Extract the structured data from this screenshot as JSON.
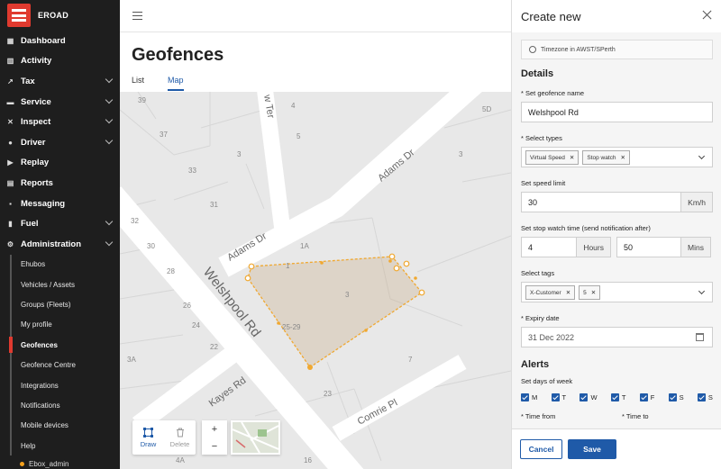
{
  "brand": {
    "name": "EROAD"
  },
  "sidebar": {
    "items": [
      {
        "label": "Dashboard",
        "icon": "grid-icon",
        "chevron": false
      },
      {
        "label": "Activity",
        "icon": "map-icon",
        "chevron": false
      },
      {
        "label": "Tax",
        "icon": "chart-icon",
        "chevron": true
      },
      {
        "label": "Service",
        "icon": "car-icon",
        "chevron": true
      },
      {
        "label": "Inspect",
        "icon": "tools-icon",
        "chevron": true
      },
      {
        "label": "Driver",
        "icon": "person-icon",
        "chevron": true
      },
      {
        "label": "Replay",
        "icon": "video-icon",
        "chevron": false
      },
      {
        "label": "Reports",
        "icon": "report-icon",
        "chevron": false
      },
      {
        "label": "Messaging",
        "icon": "message-icon",
        "chevron": false
      },
      {
        "label": "Fuel",
        "icon": "fuel-icon",
        "chevron": true
      },
      {
        "label": "Administration",
        "icon": "admin-icon",
        "chevron": true
      }
    ],
    "sub_items": [
      {
        "label": "Ehubos",
        "active": false
      },
      {
        "label": "Vehicles / Assets",
        "active": false
      },
      {
        "label": "Groups (Fleets)",
        "active": false
      },
      {
        "label": "My profile",
        "active": false
      },
      {
        "label": "Geofences",
        "active": true
      },
      {
        "label": "Geofence Centre",
        "active": false
      },
      {
        "label": "Integrations",
        "active": false
      },
      {
        "label": "Notifications",
        "active": false
      },
      {
        "label": "Mobile devices",
        "active": false
      },
      {
        "label": "Help",
        "active": false
      }
    ],
    "user": "Ebox_admin"
  },
  "main": {
    "title": "Geofences",
    "tabs": [
      {
        "label": "List",
        "active": false
      },
      {
        "label": "Map",
        "active": true
      }
    ],
    "map": {
      "streets": [
        "Welshpool Rd",
        "Adams Dr",
        "Adams Dr",
        "Kayes Rd",
        "Comrie Pl",
        "w Ter"
      ],
      "lot_numbers": [
        "39",
        "37",
        "3",
        "33",
        "31",
        "32",
        "30",
        "28",
        "26",
        "24",
        "22",
        "3A",
        "4",
        "5",
        "3",
        "1A",
        "1",
        "3",
        "7",
        "5D",
        "23",
        "16",
        "4A",
        "25-29"
      ]
    },
    "toolbar": {
      "draw": "Draw",
      "delete": "Delete",
      "zoom_in": "+",
      "zoom_out": "−"
    }
  },
  "panel": {
    "title": "Create new",
    "timezone": "Timezone in AWST/SPerth",
    "details_heading": "Details",
    "name_label": "* Set geofence name",
    "name_value": "Welshpool Rd",
    "types_label": "* Select types",
    "types": [
      "Virtual Speed",
      "Stop watch"
    ],
    "speed_label": "Set speed limit",
    "speed_value": "30",
    "speed_unit": "Km/h",
    "stop_label": "Set stop watch time (send notification after)",
    "hours_value": "4",
    "hours_unit": "Hours",
    "mins_value": "50",
    "mins_unit": "Mins",
    "tags_label": "Select tags",
    "tags": [
      "X-Customer",
      "5"
    ],
    "expiry_label": "* Expiry date",
    "expiry_value": "31 Dec 2022",
    "alerts_heading": "Alerts",
    "days_label": "Set days of week",
    "days": [
      "M",
      "T",
      "W",
      "T",
      "F",
      "S",
      "S"
    ],
    "time_from_label": "* Time from",
    "time_to_label": "* Time to",
    "cancel_label": "Cancel",
    "save_label": "Save"
  },
  "colors": {
    "accent": "#1f5aa8",
    "brand": "#e03a2f",
    "geofence": "#f0a830"
  }
}
